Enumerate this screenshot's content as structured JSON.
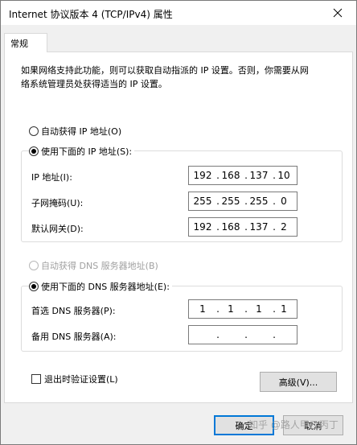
{
  "window": {
    "title": "Internet 协议版本 4 (TCP/IPv4) 属性"
  },
  "tabs": [
    {
      "label": "常规",
      "active": true
    }
  ],
  "intro_text": "如果网络支持此功能，则可以获取自动指派的 IP 设置。否则，你需要从网\n络系统管理员处获得适当的 IP 设置。",
  "ip_mode": {
    "auto_label": "自动获得 IP 地址(O)",
    "manual_label": "使用下面的 IP 地址(S):",
    "selected": "manual"
  },
  "ip_fields": {
    "ip_address": {
      "label": "IP 地址(I):",
      "octets": [
        "192",
        "168",
        "137",
        "10"
      ]
    },
    "subnet_mask": {
      "label": "子网掩码(U):",
      "octets": [
        "255",
        "255",
        "255",
        "0"
      ]
    },
    "default_gateway": {
      "label": "默认网关(D):",
      "octets": [
        "192",
        "168",
        "137",
        "2"
      ]
    }
  },
  "dns_mode": {
    "auto_label": "自动获得 DNS 服务器地址(B)",
    "manual_label": "使用下面的 DNS 服务器地址(E):",
    "selected": "manual",
    "auto_disabled": true
  },
  "dns_fields": {
    "preferred": {
      "label": "首选 DNS 服务器(P):",
      "octets": [
        "1",
        "1",
        "1",
        "1"
      ]
    },
    "alternate": {
      "label": "备用 DNS 服务器(A):",
      "octets": [
        "",
        "",
        "",
        ""
      ]
    }
  },
  "validate_on_exit": {
    "label": "退出时验证设置(L)",
    "checked": false
  },
  "buttons": {
    "advanced": "高级(V)...",
    "ok": "确定",
    "cancel": "取消"
  },
  "watermark": "知乎 @路人甲乙丙丁",
  "colors": {
    "window_bg": "#f0f0f0",
    "panel_bg": "#ffffff",
    "default_button_border": "#0078d7",
    "disabled_text": "#a0a0a0"
  },
  "icons": {
    "close": "close-icon"
  }
}
